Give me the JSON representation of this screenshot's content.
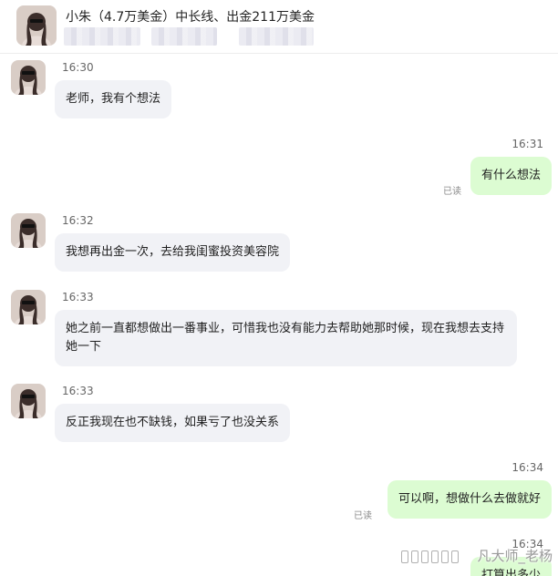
{
  "header": {
    "title": "小朱（4.7万美金）中长线、出金211万美金"
  },
  "messages": [
    {
      "side": "in",
      "time": "16:30",
      "text": "老师，我有个想法"
    },
    {
      "side": "out",
      "time": "16:31",
      "text": "有什么想法",
      "status": "已读"
    },
    {
      "side": "in",
      "time": "16:32",
      "text": "我想再出金一次，去给我闺蜜投资美容院"
    },
    {
      "side": "in",
      "time": "16:33",
      "text": "她之前一直都想做出一番事业，可惜我也没有能力去帮助她那时候，现在我想去支持她一下"
    },
    {
      "side": "in",
      "time": "16:33",
      "text": "反正我现在也不缺钱，如果亏了也没关系"
    },
    {
      "side": "out",
      "time": "16:34",
      "text": "可以啊，想做什么去做就好",
      "status": "已读"
    },
    {
      "side": "out",
      "time": "16:34",
      "text": "打算出多少"
    }
  ],
  "watermark": "凡大师_老杨",
  "colors": {
    "incoming_bubble": "#f1f2f6",
    "outgoing_bubble": "#dcfcd2"
  }
}
